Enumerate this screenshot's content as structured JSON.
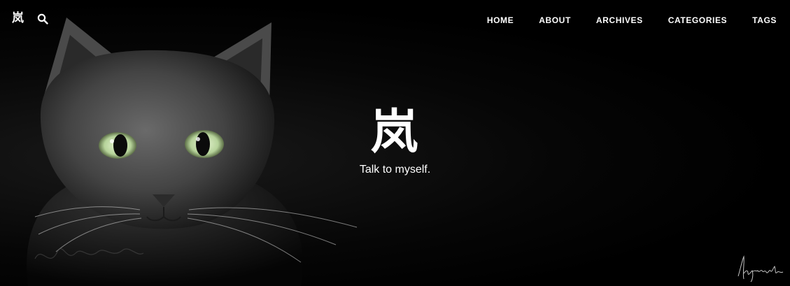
{
  "header": {
    "brand": "岚",
    "search_icon": "search-icon",
    "nav": [
      {
        "label": "HOME"
      },
      {
        "label": "ABOUT"
      },
      {
        "label": "ARCHIVES"
      },
      {
        "label": "CATEGORIES"
      },
      {
        "label": "TAGS"
      }
    ]
  },
  "hero": {
    "title": "岚",
    "subtitle": "Talk to myself.",
    "background_image": "black-cat-photo",
    "watermark": "signature-watermark"
  },
  "colors": {
    "background": "#000000",
    "text": "#ffffff",
    "cat_eye": "#b6d39a"
  }
}
